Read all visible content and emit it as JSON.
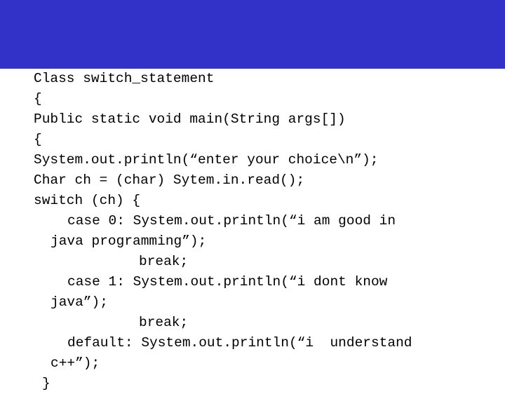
{
  "slide": {
    "banner": {
      "color": "#3232c8",
      "title": ""
    },
    "background_color": "#ffffff",
    "text_color": "#000000",
    "code_lines": [
      {
        "indent": 0,
        "text": "Class switch_statement"
      },
      {
        "indent": 0,
        "text": "{"
      },
      {
        "indent": 0,
        "text": "Public static void main(String args[])"
      },
      {
        "indent": 0,
        "text": "{"
      },
      {
        "indent": 0,
        "text": "System.out.println(“enter your choice\\n”);"
      },
      {
        "indent": 0,
        "text": "Char ch = (char) Sytem.in.read();"
      },
      {
        "indent": 0,
        "text": "switch (ch) {"
      },
      {
        "indent": 4,
        "text": "case 0: System.out.println(“i am good in"
      },
      {
        "indent": 2,
        "text": "java programming”);"
      },
      {
        "indent": 13,
        "text": "break;"
      },
      {
        "indent": 4,
        "text": "case 1: System.out.println(“i dont know"
      },
      {
        "indent": 2,
        "text": "java”);"
      },
      {
        "indent": 13,
        "text": "break;"
      },
      {
        "indent": 4,
        "text": "default: System.out.println(“i  understand"
      },
      {
        "indent": 2,
        "text": "c++”);"
      },
      {
        "indent": 1,
        "text": "}"
      }
    ]
  }
}
